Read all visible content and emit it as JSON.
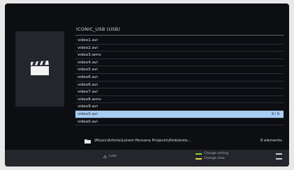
{
  "folder": {
    "title": "ICONIC_USB (USB)"
  },
  "files": [
    {
      "name": "video1.avi"
    },
    {
      "name": "video2.avi"
    },
    {
      "name": "video3.wmv"
    },
    {
      "name": "video4.avi"
    },
    {
      "name": "video5.avi"
    },
    {
      "name": "video6.avi"
    },
    {
      "name": "video6.avi"
    },
    {
      "name": "video7.avi"
    },
    {
      "name": "video8.wmv"
    },
    {
      "name": "video9.avi"
    },
    {
      "name": "video0.avi",
      "selected": true,
      "badge": "9 / 9"
    },
    {
      "name": "video0.avi"
    }
  ],
  "path_bar": {
    "path": "\\Music\\Artists\\Lorem Persona Projects\\Ambiente...",
    "count": "9 elements"
  },
  "help": {
    "list_label": "Liste",
    "change_sorting": "Change sorting",
    "change_view": "Change view"
  },
  "icons": {
    "thumbnail": "clapperboard-icon",
    "folder": "folder-icon",
    "list": "triangle-icon"
  },
  "colors": {
    "selection": "#a9cdf2",
    "green_key": "#8fcf4a",
    "yellow_key": "#e2dc4e"
  }
}
